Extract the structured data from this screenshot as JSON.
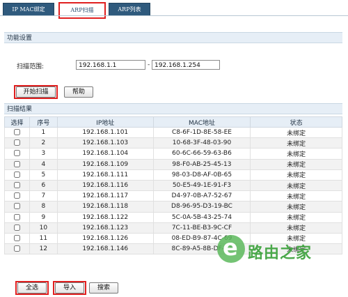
{
  "tabs": [
    {
      "label": "IP MAC绑定",
      "active": false
    },
    {
      "label": "ARP扫描",
      "active": true
    },
    {
      "label": "ARP列表",
      "active": false
    }
  ],
  "settings": {
    "title": "功能设置",
    "range_label": "扫描范围:",
    "start_ip": "192.168.1.1",
    "separator": "-",
    "end_ip": "192.168.1.254",
    "start_button": "开始扫描",
    "help_button": "帮助"
  },
  "results": {
    "title": "扫描结果",
    "columns": [
      "选择",
      "序号",
      "IP地址",
      "MAC地址",
      "状态"
    ],
    "rows": [
      {
        "no": "1",
        "ip": "192.168.1.101",
        "mac": "C8-6F-1D-8E-58-EE",
        "status": "未绑定"
      },
      {
        "no": "2",
        "ip": "192.168.1.103",
        "mac": "10-68-3F-48-03-90",
        "status": "未绑定"
      },
      {
        "no": "3",
        "ip": "192.168.1.104",
        "mac": "60-6C-66-59-63-B6",
        "status": "未绑定"
      },
      {
        "no": "4",
        "ip": "192.168.1.109",
        "mac": "98-F0-AB-25-45-13",
        "status": "未绑定"
      },
      {
        "no": "5",
        "ip": "192.168.1.111",
        "mac": "98-03-D8-AF-0B-65",
        "status": "未绑定"
      },
      {
        "no": "6",
        "ip": "192.168.1.116",
        "mac": "50-E5-49-1E-91-F3",
        "status": "未绑定"
      },
      {
        "no": "7",
        "ip": "192.168.1.117",
        "mac": "D4-97-0B-A7-52-67",
        "status": "未绑定"
      },
      {
        "no": "8",
        "ip": "192.168.1.118",
        "mac": "D8-96-95-D3-19-BC",
        "status": "未绑定"
      },
      {
        "no": "9",
        "ip": "192.168.1.122",
        "mac": "5C-0A-5B-43-25-74",
        "status": "未绑定"
      },
      {
        "no": "10",
        "ip": "192.168.1.123",
        "mac": "7C-11-BE-B3-9C-CF",
        "status": "未绑定"
      },
      {
        "no": "11",
        "ip": "192.168.1.126",
        "mac": "08-ED-B9-87-4C-69",
        "status": "未绑定"
      },
      {
        "no": "12",
        "ip": "192.168.1.146",
        "mac": "8C-89-A5-8B-DF-52",
        "status": "未绑定"
      }
    ]
  },
  "footer": {
    "select_all": "全选",
    "import": "导入",
    "search": "搜索"
  },
  "watermark": {
    "text": "路由之家",
    "glyph": "e"
  },
  "colors": {
    "tab_bg": "#2f5a7d",
    "highlight": "#e02020",
    "header_bg": "#e6eef6"
  }
}
